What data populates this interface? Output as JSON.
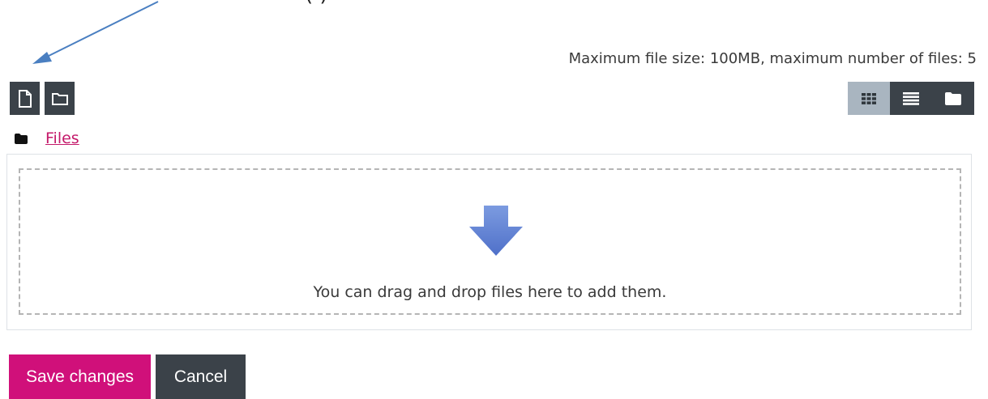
{
  "header": {
    "cropped_text": "(                                                         )",
    "limits_text": "Maximum file size: 100MB, maximum number of files: 5"
  },
  "toolbar": {
    "add_file_icon": "file-icon",
    "create_folder_icon": "folder-icon",
    "view_icons_icon": "grid-icon",
    "view_list_icon": "list-icon",
    "view_tree_icon": "folder-icon"
  },
  "breadcrumb": {
    "label": "Files"
  },
  "dropzone": {
    "message": "You can drag and drop files here to add them."
  },
  "actions": {
    "save_label": "Save changes",
    "cancel_label": "Cancel"
  },
  "colors": {
    "primary": "#d0107a",
    "dark_button": "#3b4249",
    "active_view": "#a9b5c0",
    "link": "#c4196a",
    "annotation_arrow": "#4a7fc1"
  }
}
